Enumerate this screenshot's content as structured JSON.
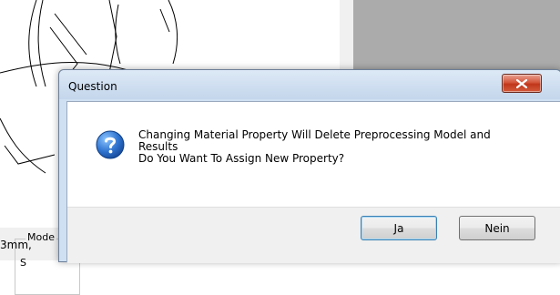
{
  "background": {
    "group_label": "Mode",
    "radio_label": "S",
    "status_text": "3mm,"
  },
  "dialog": {
    "title": "Question",
    "close_label": "x",
    "icon": "question-icon",
    "message_lines": [
      "Changing Material Property Will Delete Preprocessing Model and",
      "Results",
      "Do You Want To Assign New Property?"
    ],
    "buttons": {
      "yes_label": "Ja",
      "no_label": "Nein"
    }
  },
  "colors": {
    "titlebar": "#c4d6ec",
    "close_button": "#c0361b",
    "icon_blue": "#1f5fb8",
    "background_panel": "#ababab"
  }
}
